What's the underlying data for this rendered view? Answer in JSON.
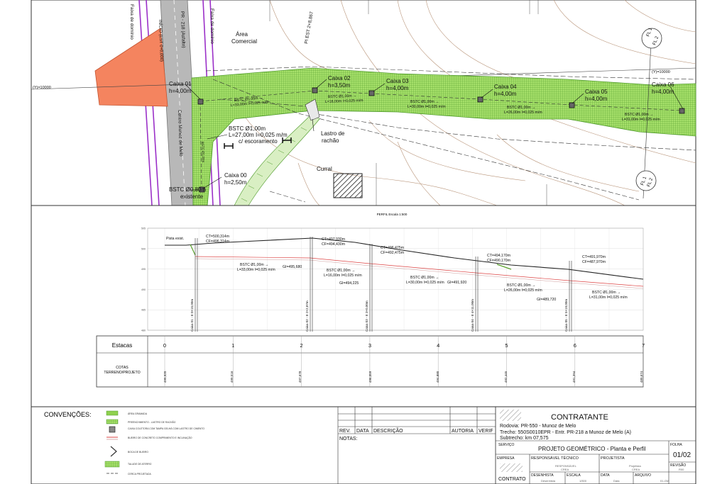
{
  "plan": {
    "labels": {
      "faixa_left": "Faixa de domínio",
      "faixa_right": "Faixa de domínio",
      "highway": "PR - 218 (Asfalto)",
      "inicio": "INÍCIO (EST 0+0,000)",
      "area1": "Área",
      "area2": "Comercial",
      "pi_est": "PI EST 2+8,867",
      "street": "Centro Munoz de Melo",
      "y_left": "(Y)=10000",
      "y_right": "(Y)=10000",
      "fl_top": "FL 1",
      "fl_top2": "FL 2",
      "fl_bottom": "FL 1",
      "fl_bottom2": "FL 2",
      "lastro1": "Lastro de",
      "lastro2": "rachão",
      "curral": "Curral"
    },
    "boxes": [
      {
        "name": "Caixa 01",
        "h": "h=4,00m"
      },
      {
        "name": "Caixa 02",
        "h": "h=3,50m"
      },
      {
        "name": "Caixa 03",
        "h": "h=4,00m"
      },
      {
        "name": "Caixa 04",
        "h": "h=4,00m"
      },
      {
        "name": "Caixa 05",
        "h": "h=4,00m"
      },
      {
        "name": "Caixa 06",
        "h": "h=4,00m"
      },
      {
        "name": "Caixa 00",
        "h": "h=2,50m"
      }
    ],
    "pipes": [
      {
        "l1": "BSTC Ø1,00m →",
        "l2": "L=33,00m I=0,025 m/m"
      },
      {
        "l1": "BSTC Ø1,00m →",
        "l2": "L=16,00m I=0,025 m/m"
      },
      {
        "l1": "BSTC Ø1,00m →",
        "l2": "L=30,00m I=0,025 m/m"
      },
      {
        "l1": "BSTC Ø1,00m →",
        "l2": "L=26,00m I=0,025 m/m"
      },
      {
        "l1": "BSTC Ø1,00m →",
        "l2": "L=31,00m I=0,025 m/m"
      }
    ],
    "callout_a": [
      "BSTC Ø1,00m",
      "L=27,00m I=0,025 m/m",
      "c/ escoramento"
    ],
    "callout_b": [
      "BSTC Ø0,80m",
      "existente"
    ],
    "small_pipe": "BSTC Ø1,00m"
  },
  "profile": {
    "title": "PERFIL Escala 1:500",
    "pista": "Pista exist.",
    "ct_cf": [
      [
        "CT=500,314m",
        "CF=496,314m"
      ],
      [
        "CT=497,930m",
        "CF=494,430m"
      ],
      [
        "CT=496,475m",
        "CF=492,475m"
      ],
      [
        "CT=494,170m",
        "CF=490,170m"
      ],
      [
        "CT=491,970m",
        "CF=487,970m"
      ]
    ],
    "gi": [
      "GI=495,680",
      "GI=494,225",
      "GI=491,920",
      "GI=489,720"
    ],
    "pipes": [
      [
        "BSTC Ø1,00m →",
        "L=33,00m I=0,025 m/m"
      ],
      [
        "BSTC Ø1,00m →",
        "L=16,00m I=0,025 m/m"
      ],
      [
        "BSTC Ø1,00m →",
        "L=30,00m I=0,025 m/m"
      ],
      [
        "BSTC Ø1,00m →",
        "L=26,00m I=0,025 m/m"
      ],
      [
        "BSTC Ø1,00m →",
        "L=31,00m I=0,025 m/m"
      ]
    ],
    "verticals": [
      "Caixa 01 - E 0+15,00m",
      "Caixa 02 - E 2+2,87m",
      "Caixa 03 - E 3+0,00m",
      "Caixa 04 - E 4+11,00m",
      "Caixa 05 - E 5+19,00m"
    ],
    "y_ticks": [
      "505",
      "500",
      "495",
      "490",
      "485",
      "480"
    ],
    "estacas_label": "Estacas",
    "estacas": [
      "0",
      "1",
      "2",
      "3",
      "4",
      "5",
      "6",
      "7"
    ],
    "cotas_label1": "COTAS",
    "cotas_label2": "TERRENO/PROJETO",
    "cotas": [
      "499,920",
      "499,516",
      "497,678",
      "496,059",
      "494,880",
      "492,445",
      "491,394",
      "489,674"
    ]
  },
  "legend": {
    "title": "CONVENÇÕES:",
    "items": [
      "ÁREA GRAMADA",
      "PREENCHIMENTO - LASTRO DE RACHÃO",
      "CAIXA COLETORA COM TAMPA GELHÁ COM LASTRO DE CIMENTO",
      "BUEIRO DE CONCRETO COMPRIMENTO E INCLINAÇÃO",
      "BOCA DE BUEIRO",
      "TALUDE DE ATERRO",
      "CERCA PROJETADA"
    ],
    "colors": {
      "grass": "#8fd14f",
      "grass_dark": "#6aa84f",
      "orange": "#f4845f",
      "purple": "#9b30c8",
      "asphalt": "#b8b8b8"
    }
  },
  "revisions": {
    "headers": [
      "REV.",
      "DATA",
      "DESCRIÇÃO",
      "AUTORIA",
      "VERIF"
    ],
    "notes_label": "NOTAS:"
  },
  "titleblock": {
    "contratante": "CONTRATANTE",
    "rodovia": "Rodovia:   PR-550 - Munoz de Melo",
    "trecho": "Trecho:     550S0010EPR - Entr. PR-218 a Munoz de Melo (A)",
    "subtrecho": "Subtrecho: km 07,575",
    "servico_label": "SERVIÇO",
    "servico": "PROJETO GEOMÉTRICO - Planta e Perfil",
    "folha_label": "FOLHA",
    "folha": "01/02",
    "empresa_label": "EMPRESA",
    "resp_label": "RESPONSÁVEL TÉCNICO",
    "resp_value": "RESPONSÁVEL",
    "resp_value2": "CREA",
    "projetista_label": "PROJETISTA",
    "projetista_value": "Projetista",
    "projetista_value2": "CREA",
    "revisao_label": "REVISÃO",
    "revisao_value": "R00",
    "contrato": "CONTRATO",
    "desenhista_label": "DESENHISTA",
    "desenhista_value": "Desenhista",
    "escala_label": "ESCALA",
    "escala_value": "1/500",
    "data_label": "DATA",
    "data_value": "Data",
    "arquivo_label": "ARQUIVO",
    "arquivo_value": "01-GM"
  }
}
